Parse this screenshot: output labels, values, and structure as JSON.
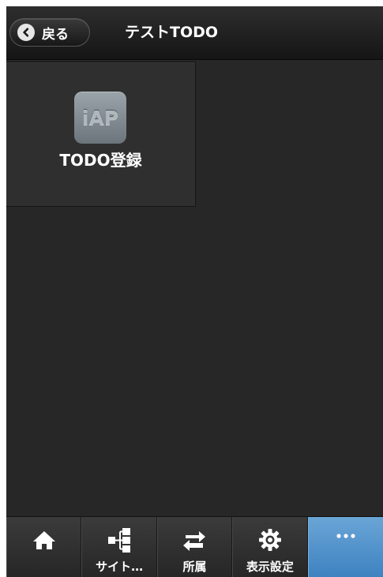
{
  "header": {
    "back_label": "戻る",
    "title": "テストTODO"
  },
  "content": {
    "tiles": [
      {
        "icon": "iap-app-icon",
        "icon_text": "iAP",
        "label": "TODO登録"
      }
    ]
  },
  "tabbar": {
    "tabs": [
      {
        "icon": "home-icon",
        "label": ""
      },
      {
        "icon": "sitemap-icon",
        "label": "サイト…"
      },
      {
        "icon": "switch-arrows-icon",
        "label": "所属"
      },
      {
        "icon": "gear-icon",
        "label": "表示設定"
      },
      {
        "icon": "more-icon",
        "label": ""
      }
    ],
    "active_index": 4
  },
  "colors": {
    "background": "#262626",
    "header": "#1e1e1e",
    "tab_active": "#4e91cc",
    "text": "#ffffff"
  }
}
